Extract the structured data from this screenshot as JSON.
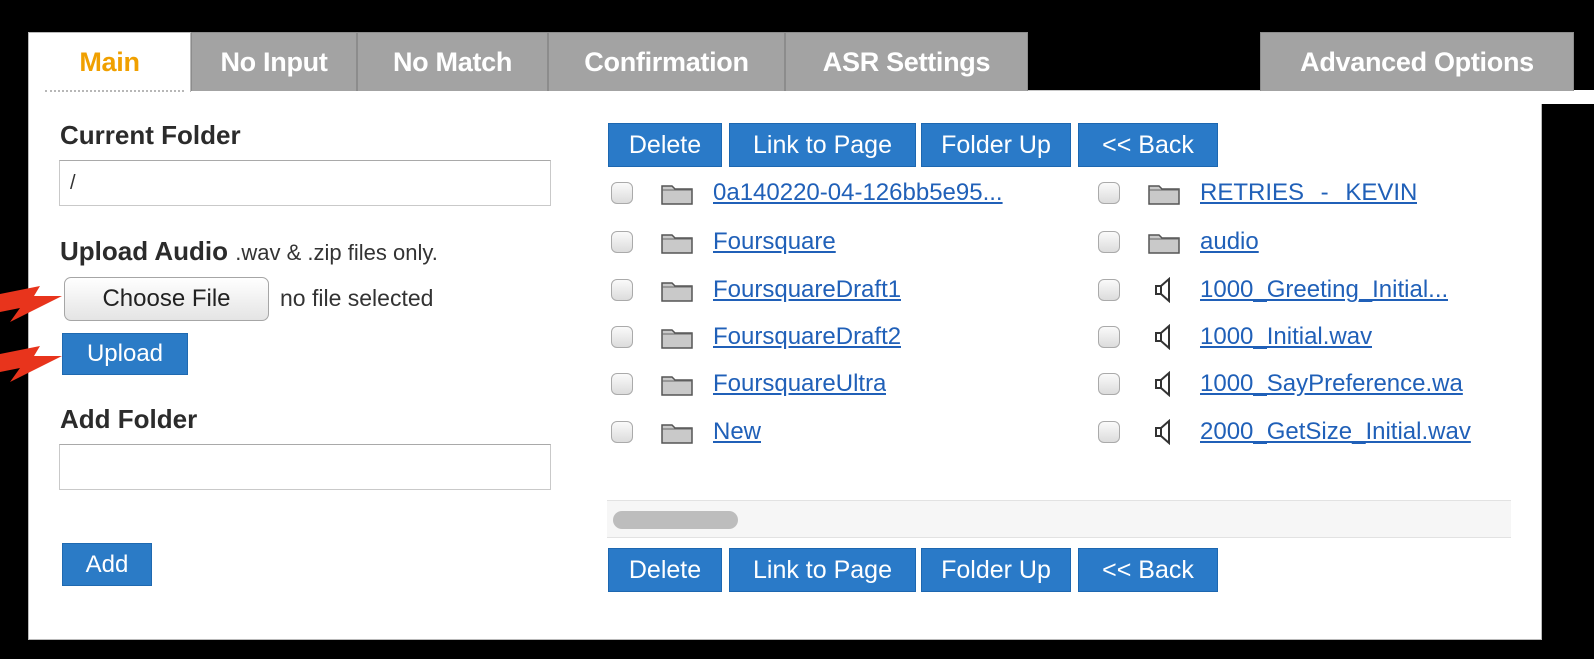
{
  "tabs": [
    {
      "label": "Main",
      "active": true
    },
    {
      "label": "No Input",
      "active": false
    },
    {
      "label": "No Match",
      "active": false
    },
    {
      "label": "Confirmation",
      "active": false
    },
    {
      "label": "ASR Settings",
      "active": false
    },
    {
      "label": "Advanced Options",
      "active": false
    }
  ],
  "left": {
    "current_folder_label": "Current Folder",
    "current_folder_value": "/",
    "upload_label": "Upload Audio",
    "upload_hint": ".wav & .zip files only.",
    "choose_file_label": "Choose File",
    "no_file_text": "no file selected",
    "upload_button": "Upload",
    "add_folder_label": "Add Folder",
    "add_folder_value": "",
    "add_button": "Add"
  },
  "toolbar": {
    "delete": "Delete",
    "link_to_page": "Link to Page",
    "folder_up": "Folder Up",
    "back": "<< Back"
  },
  "files_left": [
    {
      "name": "0a140220-04-126bb5e95...",
      "type": "folder"
    },
    {
      "name": "Foursquare",
      "type": "folder"
    },
    {
      "name": "FoursquareDraft1",
      "type": "folder"
    },
    {
      "name": "FoursquareDraft2",
      "type": "folder"
    },
    {
      "name": "FoursquareUltra",
      "type": "folder"
    },
    {
      "name": "New",
      "type": "folder"
    }
  ],
  "files_right": [
    {
      "name": "RETRIES - KEVIN",
      "type": "folder"
    },
    {
      "name": "audio",
      "type": "folder"
    },
    {
      "name": "1000_Greeting_Initial...",
      "type": "audio"
    },
    {
      "name": "1000_Initial.wav",
      "type": "audio"
    },
    {
      "name": "1000_SayPreference.wa",
      "type": "audio"
    },
    {
      "name": "2000_GetSize_Initial.wav",
      "type": "audio"
    }
  ],
  "colors": {
    "active_tab_text": "#f0a000",
    "button_blue": "#2a7ac8",
    "link_blue": "#2060b8",
    "arrow_red": "#e8341c"
  },
  "icons": {
    "folder": "folder-icon",
    "audio": "speaker-icon",
    "arrow": "red-arrow-icon"
  }
}
